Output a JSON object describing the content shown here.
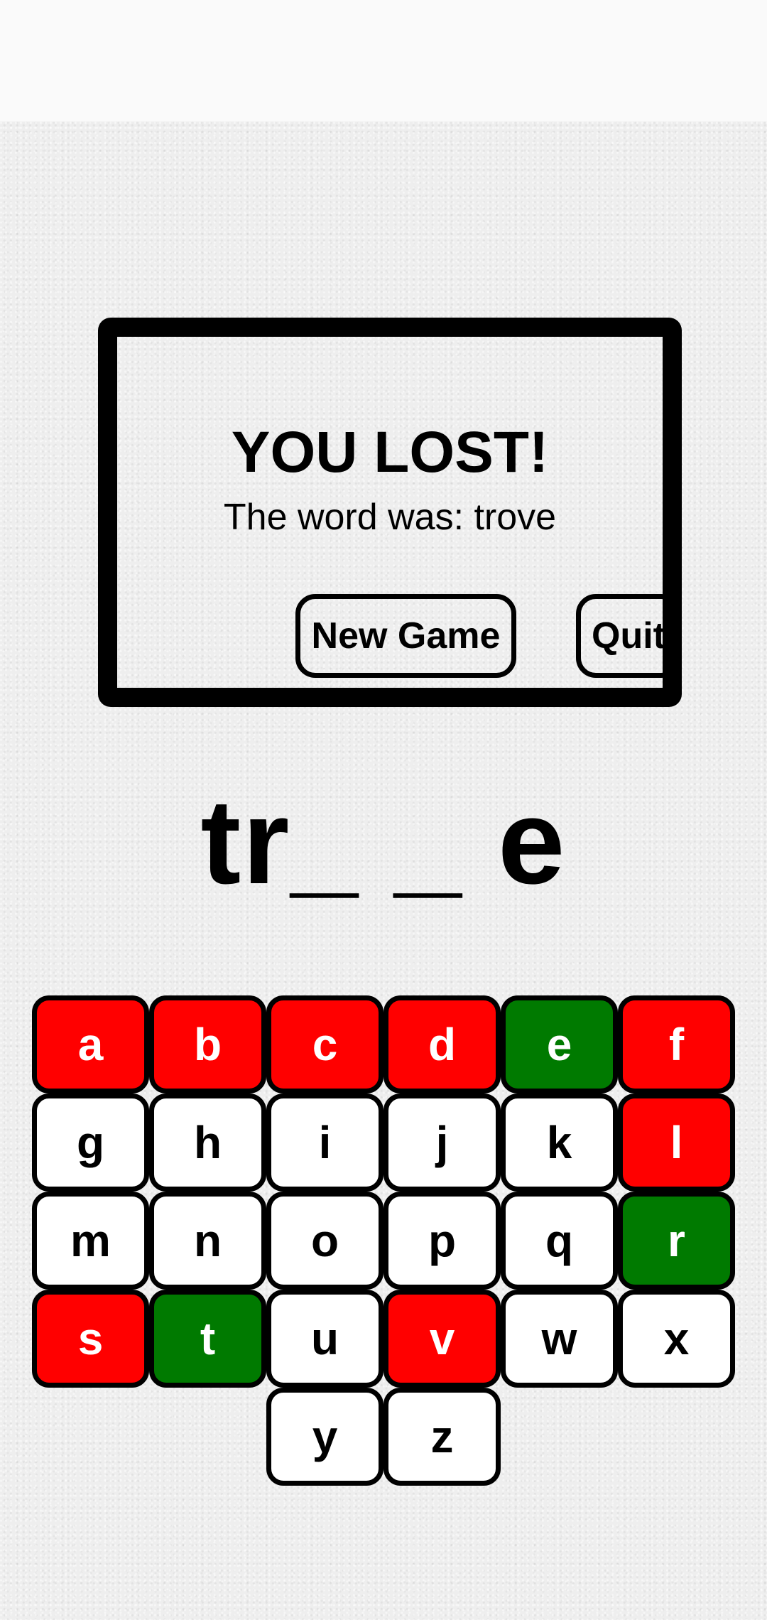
{
  "colors": {
    "wrong": "#ff0000",
    "correct": "#007a00",
    "unused": "#ffffff"
  },
  "dialog": {
    "title": "YOU LOST!",
    "message": "The word was: trove",
    "new_game_label": "New Game",
    "quit_label": "Quit"
  },
  "game": {
    "word_display": "tr_ _ e"
  },
  "keyboard": {
    "rows": [
      [
        {
          "letter": "a",
          "state": "wrong"
        },
        {
          "letter": "b",
          "state": "wrong"
        },
        {
          "letter": "c",
          "state": "wrong"
        },
        {
          "letter": "d",
          "state": "wrong"
        },
        {
          "letter": "e",
          "state": "correct"
        },
        {
          "letter": "f",
          "state": "wrong"
        }
      ],
      [
        {
          "letter": "g",
          "state": "unused"
        },
        {
          "letter": "h",
          "state": "unused"
        },
        {
          "letter": "i",
          "state": "unused"
        },
        {
          "letter": "j",
          "state": "unused"
        },
        {
          "letter": "k",
          "state": "unused"
        },
        {
          "letter": "l",
          "state": "wrong"
        }
      ],
      [
        {
          "letter": "m",
          "state": "unused"
        },
        {
          "letter": "n",
          "state": "unused"
        },
        {
          "letter": "o",
          "state": "unused"
        },
        {
          "letter": "p",
          "state": "unused"
        },
        {
          "letter": "q",
          "state": "unused"
        },
        {
          "letter": "r",
          "state": "correct"
        }
      ],
      [
        {
          "letter": "s",
          "state": "wrong"
        },
        {
          "letter": "t",
          "state": "correct"
        },
        {
          "letter": "u",
          "state": "unused"
        },
        {
          "letter": "v",
          "state": "wrong"
        },
        {
          "letter": "w",
          "state": "unused"
        },
        {
          "letter": "x",
          "state": "unused"
        }
      ],
      [
        {
          "letter": "y",
          "state": "unused"
        },
        {
          "letter": "z",
          "state": "unused"
        }
      ]
    ]
  }
}
